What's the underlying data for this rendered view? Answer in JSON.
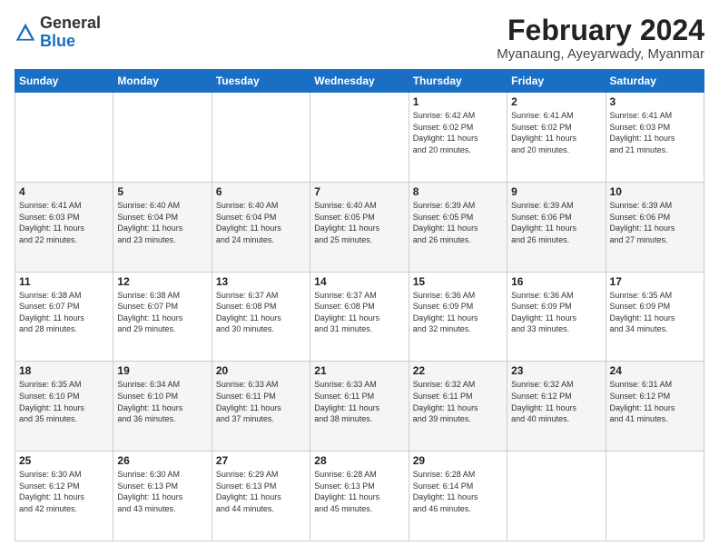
{
  "header": {
    "logo_general": "General",
    "logo_blue": "Blue",
    "month_title": "February 2024",
    "location": "Myanaung, Ayeyarwady, Myanmar"
  },
  "weekdays": [
    "Sunday",
    "Monday",
    "Tuesday",
    "Wednesday",
    "Thursday",
    "Friday",
    "Saturday"
  ],
  "weeks": [
    [
      {
        "day": "",
        "info": ""
      },
      {
        "day": "",
        "info": ""
      },
      {
        "day": "",
        "info": ""
      },
      {
        "day": "",
        "info": ""
      },
      {
        "day": "1",
        "info": "Sunrise: 6:42 AM\nSunset: 6:02 PM\nDaylight: 11 hours\nand 20 minutes."
      },
      {
        "day": "2",
        "info": "Sunrise: 6:41 AM\nSunset: 6:02 PM\nDaylight: 11 hours\nand 20 minutes."
      },
      {
        "day": "3",
        "info": "Sunrise: 6:41 AM\nSunset: 6:03 PM\nDaylight: 11 hours\nand 21 minutes."
      }
    ],
    [
      {
        "day": "4",
        "info": "Sunrise: 6:41 AM\nSunset: 6:03 PM\nDaylight: 11 hours\nand 22 minutes."
      },
      {
        "day": "5",
        "info": "Sunrise: 6:40 AM\nSunset: 6:04 PM\nDaylight: 11 hours\nand 23 minutes."
      },
      {
        "day": "6",
        "info": "Sunrise: 6:40 AM\nSunset: 6:04 PM\nDaylight: 11 hours\nand 24 minutes."
      },
      {
        "day": "7",
        "info": "Sunrise: 6:40 AM\nSunset: 6:05 PM\nDaylight: 11 hours\nand 25 minutes."
      },
      {
        "day": "8",
        "info": "Sunrise: 6:39 AM\nSunset: 6:05 PM\nDaylight: 11 hours\nand 26 minutes."
      },
      {
        "day": "9",
        "info": "Sunrise: 6:39 AM\nSunset: 6:06 PM\nDaylight: 11 hours\nand 26 minutes."
      },
      {
        "day": "10",
        "info": "Sunrise: 6:39 AM\nSunset: 6:06 PM\nDaylight: 11 hours\nand 27 minutes."
      }
    ],
    [
      {
        "day": "11",
        "info": "Sunrise: 6:38 AM\nSunset: 6:07 PM\nDaylight: 11 hours\nand 28 minutes."
      },
      {
        "day": "12",
        "info": "Sunrise: 6:38 AM\nSunset: 6:07 PM\nDaylight: 11 hours\nand 29 minutes."
      },
      {
        "day": "13",
        "info": "Sunrise: 6:37 AM\nSunset: 6:08 PM\nDaylight: 11 hours\nand 30 minutes."
      },
      {
        "day": "14",
        "info": "Sunrise: 6:37 AM\nSunset: 6:08 PM\nDaylight: 11 hours\nand 31 minutes."
      },
      {
        "day": "15",
        "info": "Sunrise: 6:36 AM\nSunset: 6:09 PM\nDaylight: 11 hours\nand 32 minutes."
      },
      {
        "day": "16",
        "info": "Sunrise: 6:36 AM\nSunset: 6:09 PM\nDaylight: 11 hours\nand 33 minutes."
      },
      {
        "day": "17",
        "info": "Sunrise: 6:35 AM\nSunset: 6:09 PM\nDaylight: 11 hours\nand 34 minutes."
      }
    ],
    [
      {
        "day": "18",
        "info": "Sunrise: 6:35 AM\nSunset: 6:10 PM\nDaylight: 11 hours\nand 35 minutes."
      },
      {
        "day": "19",
        "info": "Sunrise: 6:34 AM\nSunset: 6:10 PM\nDaylight: 11 hours\nand 36 minutes."
      },
      {
        "day": "20",
        "info": "Sunrise: 6:33 AM\nSunset: 6:11 PM\nDaylight: 11 hours\nand 37 minutes."
      },
      {
        "day": "21",
        "info": "Sunrise: 6:33 AM\nSunset: 6:11 PM\nDaylight: 11 hours\nand 38 minutes."
      },
      {
        "day": "22",
        "info": "Sunrise: 6:32 AM\nSunset: 6:11 PM\nDaylight: 11 hours\nand 39 minutes."
      },
      {
        "day": "23",
        "info": "Sunrise: 6:32 AM\nSunset: 6:12 PM\nDaylight: 11 hours\nand 40 minutes."
      },
      {
        "day": "24",
        "info": "Sunrise: 6:31 AM\nSunset: 6:12 PM\nDaylight: 11 hours\nand 41 minutes."
      }
    ],
    [
      {
        "day": "25",
        "info": "Sunrise: 6:30 AM\nSunset: 6:12 PM\nDaylight: 11 hours\nand 42 minutes."
      },
      {
        "day": "26",
        "info": "Sunrise: 6:30 AM\nSunset: 6:13 PM\nDaylight: 11 hours\nand 43 minutes."
      },
      {
        "day": "27",
        "info": "Sunrise: 6:29 AM\nSunset: 6:13 PM\nDaylight: 11 hours\nand 44 minutes."
      },
      {
        "day": "28",
        "info": "Sunrise: 6:28 AM\nSunset: 6:13 PM\nDaylight: 11 hours\nand 45 minutes."
      },
      {
        "day": "29",
        "info": "Sunrise: 6:28 AM\nSunset: 6:14 PM\nDaylight: 11 hours\nand 46 minutes."
      },
      {
        "day": "",
        "info": ""
      },
      {
        "day": "",
        "info": ""
      }
    ]
  ]
}
